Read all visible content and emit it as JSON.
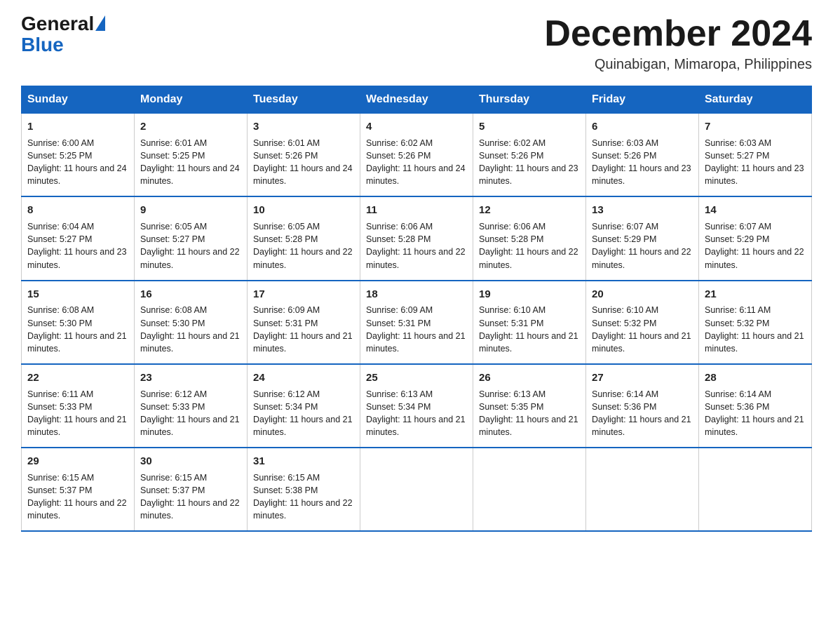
{
  "logo": {
    "general": "General",
    "blue": "Blue"
  },
  "title": "December 2024",
  "location": "Quinabigan, Mimaropa, Philippines",
  "headers": [
    "Sunday",
    "Monday",
    "Tuesday",
    "Wednesday",
    "Thursday",
    "Friday",
    "Saturday"
  ],
  "weeks": [
    [
      {
        "day": "1",
        "sunrise": "6:00 AM",
        "sunset": "5:25 PM",
        "daylight": "11 hours and 24 minutes."
      },
      {
        "day": "2",
        "sunrise": "6:01 AM",
        "sunset": "5:25 PM",
        "daylight": "11 hours and 24 minutes."
      },
      {
        "day": "3",
        "sunrise": "6:01 AM",
        "sunset": "5:26 PM",
        "daylight": "11 hours and 24 minutes."
      },
      {
        "day": "4",
        "sunrise": "6:02 AM",
        "sunset": "5:26 PM",
        "daylight": "11 hours and 24 minutes."
      },
      {
        "day": "5",
        "sunrise": "6:02 AM",
        "sunset": "5:26 PM",
        "daylight": "11 hours and 23 minutes."
      },
      {
        "day": "6",
        "sunrise": "6:03 AM",
        "sunset": "5:26 PM",
        "daylight": "11 hours and 23 minutes."
      },
      {
        "day": "7",
        "sunrise": "6:03 AM",
        "sunset": "5:27 PM",
        "daylight": "11 hours and 23 minutes."
      }
    ],
    [
      {
        "day": "8",
        "sunrise": "6:04 AM",
        "sunset": "5:27 PM",
        "daylight": "11 hours and 23 minutes."
      },
      {
        "day": "9",
        "sunrise": "6:05 AM",
        "sunset": "5:27 PM",
        "daylight": "11 hours and 22 minutes."
      },
      {
        "day": "10",
        "sunrise": "6:05 AM",
        "sunset": "5:28 PM",
        "daylight": "11 hours and 22 minutes."
      },
      {
        "day": "11",
        "sunrise": "6:06 AM",
        "sunset": "5:28 PM",
        "daylight": "11 hours and 22 minutes."
      },
      {
        "day": "12",
        "sunrise": "6:06 AM",
        "sunset": "5:28 PM",
        "daylight": "11 hours and 22 minutes."
      },
      {
        "day": "13",
        "sunrise": "6:07 AM",
        "sunset": "5:29 PM",
        "daylight": "11 hours and 22 minutes."
      },
      {
        "day": "14",
        "sunrise": "6:07 AM",
        "sunset": "5:29 PM",
        "daylight": "11 hours and 22 minutes."
      }
    ],
    [
      {
        "day": "15",
        "sunrise": "6:08 AM",
        "sunset": "5:30 PM",
        "daylight": "11 hours and 21 minutes."
      },
      {
        "day": "16",
        "sunrise": "6:08 AM",
        "sunset": "5:30 PM",
        "daylight": "11 hours and 21 minutes."
      },
      {
        "day": "17",
        "sunrise": "6:09 AM",
        "sunset": "5:31 PM",
        "daylight": "11 hours and 21 minutes."
      },
      {
        "day": "18",
        "sunrise": "6:09 AM",
        "sunset": "5:31 PM",
        "daylight": "11 hours and 21 minutes."
      },
      {
        "day": "19",
        "sunrise": "6:10 AM",
        "sunset": "5:31 PM",
        "daylight": "11 hours and 21 minutes."
      },
      {
        "day": "20",
        "sunrise": "6:10 AM",
        "sunset": "5:32 PM",
        "daylight": "11 hours and 21 minutes."
      },
      {
        "day": "21",
        "sunrise": "6:11 AM",
        "sunset": "5:32 PM",
        "daylight": "11 hours and 21 minutes."
      }
    ],
    [
      {
        "day": "22",
        "sunrise": "6:11 AM",
        "sunset": "5:33 PM",
        "daylight": "11 hours and 21 minutes."
      },
      {
        "day": "23",
        "sunrise": "6:12 AM",
        "sunset": "5:33 PM",
        "daylight": "11 hours and 21 minutes."
      },
      {
        "day": "24",
        "sunrise": "6:12 AM",
        "sunset": "5:34 PM",
        "daylight": "11 hours and 21 minutes."
      },
      {
        "day": "25",
        "sunrise": "6:13 AM",
        "sunset": "5:34 PM",
        "daylight": "11 hours and 21 minutes."
      },
      {
        "day": "26",
        "sunrise": "6:13 AM",
        "sunset": "5:35 PM",
        "daylight": "11 hours and 21 minutes."
      },
      {
        "day": "27",
        "sunrise": "6:14 AM",
        "sunset": "5:36 PM",
        "daylight": "11 hours and 21 minutes."
      },
      {
        "day": "28",
        "sunrise": "6:14 AM",
        "sunset": "5:36 PM",
        "daylight": "11 hours and 21 minutes."
      }
    ],
    [
      {
        "day": "29",
        "sunrise": "6:15 AM",
        "sunset": "5:37 PM",
        "daylight": "11 hours and 22 minutes."
      },
      {
        "day": "30",
        "sunrise": "6:15 AM",
        "sunset": "5:37 PM",
        "daylight": "11 hours and 22 minutes."
      },
      {
        "day": "31",
        "sunrise": "6:15 AM",
        "sunset": "5:38 PM",
        "daylight": "11 hours and 22 minutes."
      },
      null,
      null,
      null,
      null
    ]
  ]
}
